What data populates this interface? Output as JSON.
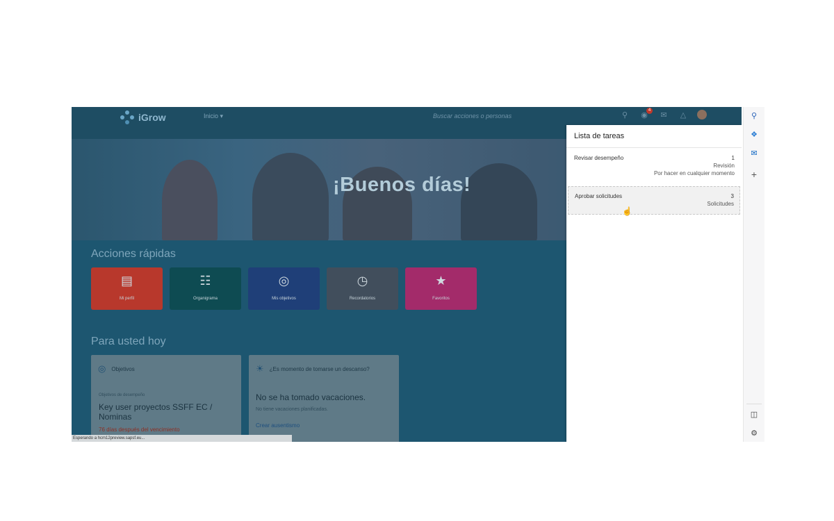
{
  "app": {
    "logo_text": "iGrow",
    "nav_home": "Inicio ▾",
    "search_placeholder": "Buscar acciones o personas",
    "notification_count": "4"
  },
  "hero": {
    "greeting": "¡Buenos días!"
  },
  "quick_actions": {
    "title": "Acciones rápidas",
    "tiles": [
      {
        "label": "Mi perfil",
        "icon": "id-card-icon",
        "color": "#b8382c"
      },
      {
        "label": "Organigrama",
        "icon": "org-chart-icon",
        "color": "#0e4b52"
      },
      {
        "label": "Mis objetivos",
        "icon": "target-icon",
        "color": "#1f3f78"
      },
      {
        "label": "Recordatorios",
        "icon": "calendar-clock-icon",
        "color": "#414e5c"
      },
      {
        "label": "Favoritos",
        "icon": "star-list-icon",
        "color": "#a32b6a"
      }
    ]
  },
  "for_you": {
    "title": "Para usted hoy",
    "goals_card": {
      "header": "Objetivos",
      "subtitle": "Objetivos de desempeño",
      "goal_title": "Key user proyectos SSFF EC / Nominas",
      "overdue": "76 días después del vencimiento"
    },
    "vacation_card": {
      "header": "¿Es momento de tomarse un descanso?",
      "title": "No se ha tomado vacaciones.",
      "subtitle": "No tiene vacaciones planificadas.",
      "link": "Crear ausentismo"
    }
  },
  "status_bar": "Esperando a hcm12preview.sapsf.eu...",
  "task_panel": {
    "title": "Lista de tareas",
    "tasks": [
      {
        "name": "Revisar desempeño",
        "count": "1",
        "type": "Revisión",
        "due": "Por hacer en cualquier momento"
      },
      {
        "name": "Aprobar solicitudes",
        "count": "3",
        "type": "Solicitudes"
      }
    ]
  },
  "browser_sidebar": {
    "icons": [
      "search-icon",
      "copilot-icon",
      "outlook-icon",
      "add-icon",
      "split-screen-icon",
      "settings-icon"
    ],
    "plus": "+"
  }
}
